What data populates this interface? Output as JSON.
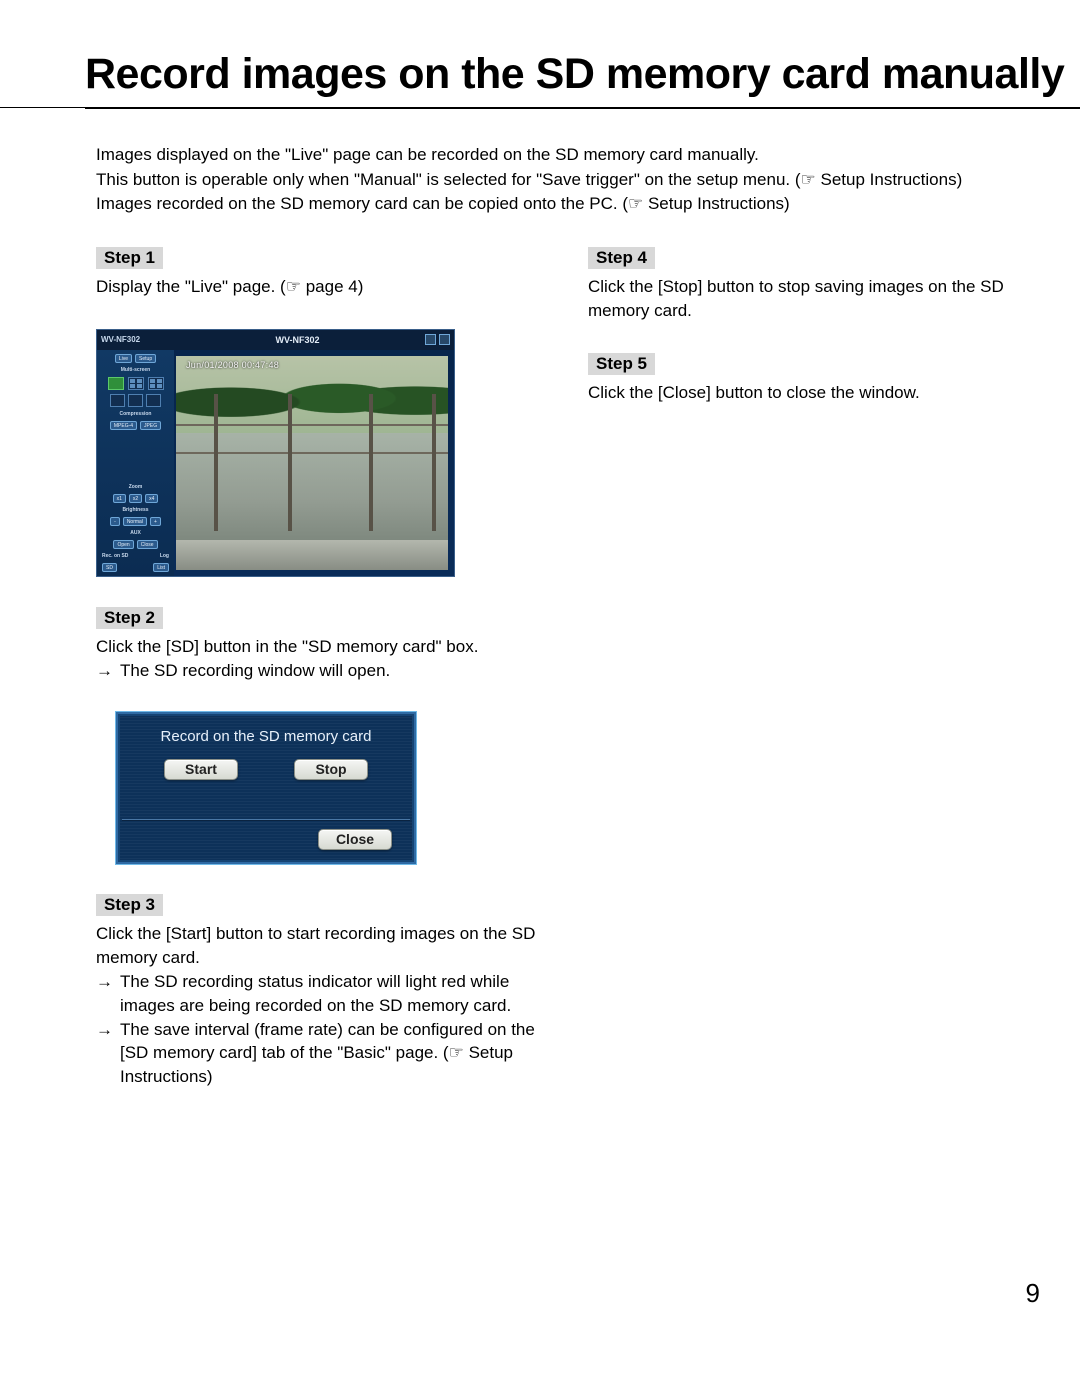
{
  "page_number": "9",
  "heading": "Record images on the SD memory card manually",
  "intro": {
    "l1": "Images displayed on the \"Live\" page can be recorded on the SD memory card manually.",
    "l2_a": "This button is operable only when \"Manual\" is selected for \"Save trigger\" on the setup menu. (",
    "l2_b": " Setup Instructions)",
    "l3_a": "Images recorded on the SD memory card can be copied onto the PC. (",
    "l3_b": " Setup Instructions)"
  },
  "steps": {
    "s1": {
      "tag": "Step 1",
      "body_a": "Display the \"Live\" page. (",
      "body_b": " page 4)"
    },
    "s2": {
      "tag": "Step 2",
      "line1": "Click the [SD] button in the \"SD memory card\" box.",
      "arrow_text": "The SD recording window will open."
    },
    "s3": {
      "tag": "Step 3",
      "line1": "Click the [Start] button to start recording images on the SD memory card.",
      "a1": "The SD recording status indicator will light red while images are being recorded on the SD memory card.",
      "a2_a": "The save interval (frame rate) can be configured on the [SD memory card] tab of the \"Basic\" page. (",
      "a2_b": " Setup Instructions)"
    },
    "s4": {
      "tag": "Step 4",
      "line1": "Click the [Stop] button to stop saving images on the SD memory card."
    },
    "s5": {
      "tag": "Step 5",
      "line1": "Click the [Close] button to close the window."
    }
  },
  "fig1": {
    "model": "WV-NF302",
    "title": "WV-NF302",
    "side": {
      "live": "Live",
      "setup": "Setup",
      "multiscreen": "Multi-screen",
      "compression": "Compression",
      "mpeg4": "MPEG-4",
      "jpeg": "JPEG",
      "zoom": "Zoom",
      "z1": "x1",
      "z2": "x2",
      "z4": "x4",
      "brightness": "Brightness",
      "bminus": "-",
      "bnormal": "Normal",
      "bplus": "+",
      "aux": "AUX",
      "open": "Open",
      "close": "Close",
      "recsd": "Rec. on SD",
      "sd": "SD",
      "log": "Log",
      "list": "List"
    },
    "caption": "Jun/01/2008 00:47:48"
  },
  "fig2": {
    "title": "Record on the SD memory card",
    "start": "Start",
    "stop": "Stop",
    "close": "Close"
  },
  "glyphs": {
    "pointer": "☞",
    "arrow": "→"
  }
}
